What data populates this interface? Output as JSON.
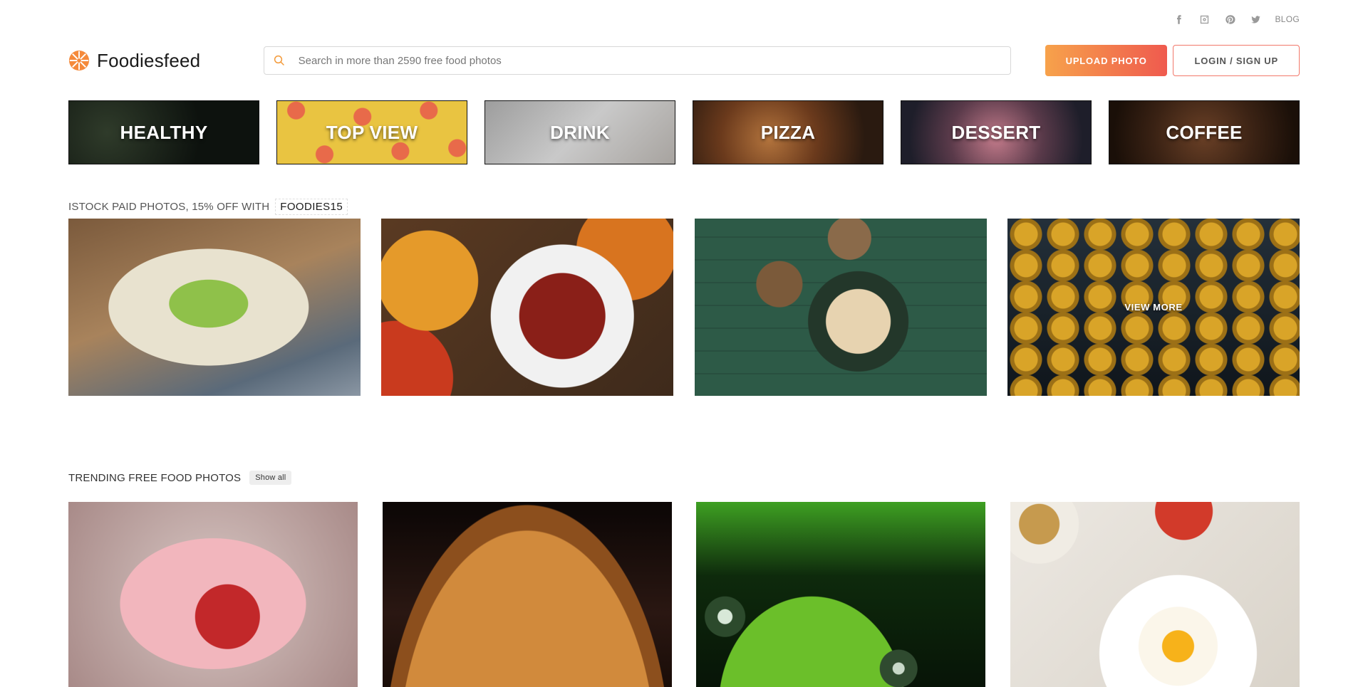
{
  "social": {
    "icons": [
      "facebook-icon",
      "instagram-icon",
      "pinterest-icon",
      "twitter-icon"
    ],
    "blog_label": "BLOG"
  },
  "header": {
    "brand": "Foodiesfeed",
    "search_placeholder": "Search in more than 2590 free food photos",
    "upload_label": "UPLOAD PHOTO",
    "login_label": "LOGIN / SIGN UP",
    "accent_colors": [
      "#f7a24b",
      "#ef5a4e"
    ]
  },
  "categories": [
    {
      "label": "HEALTHY"
    },
    {
      "label": "TOP VIEW"
    },
    {
      "label": "DRINK"
    },
    {
      "label": "PIZZA"
    },
    {
      "label": "DESSERT"
    },
    {
      "label": "COFFEE"
    }
  ],
  "istock": {
    "heading": "ISTOCK PAID PHOTOS, 15% OFF WITH",
    "promo_code": "FOODIES15",
    "view_more_label": "VIEW MORE"
  },
  "trending": {
    "heading": "TRENDING FREE FOOD PHOTOS",
    "show_all_label": "Show all"
  }
}
